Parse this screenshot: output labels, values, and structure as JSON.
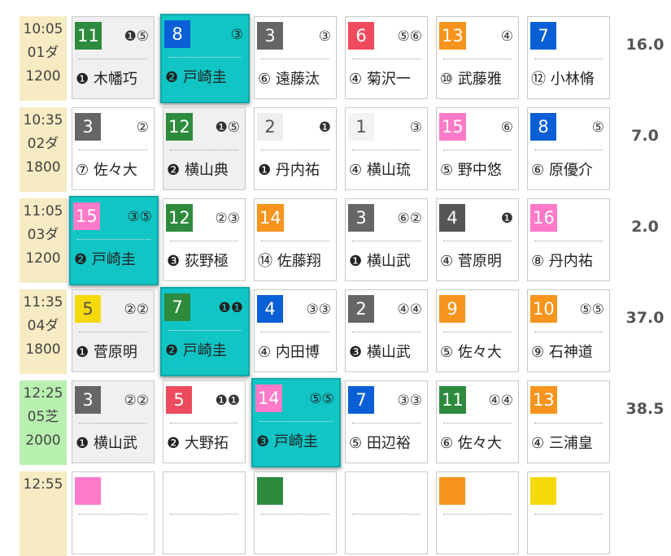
{
  "colors": {
    "highlight": "#11c5c5",
    "dirt_bg": "#f6ebc2",
    "turf_bg": "#b8f0b0"
  },
  "races": [
    {
      "time": "10:05",
      "code": "01ダ",
      "distance": "1200",
      "surface": "dirt",
      "odds": "16.0",
      "horses": [
        {
          "num": "11",
          "color": "#2e8b3e",
          "marks": "❶⑤",
          "jockey": "❶ 木幡巧",
          "highlight": false,
          "dim": true
        },
        {
          "num": "8",
          "color": "#0a5fd6",
          "marks": "③",
          "jockey": "❷ 戸崎圭",
          "highlight": true
        },
        {
          "num": "3",
          "color": "#666666",
          "marks": "③",
          "jockey": "⑥ 遠藤汰",
          "highlight": false
        },
        {
          "num": "6",
          "color": "#ee4b5e",
          "marks": "⑤⑥",
          "jockey": "④ 菊沢一",
          "highlight": false
        },
        {
          "num": "13",
          "color": "#f7941d",
          "marks": "④",
          "jockey": "⑩ 武藤雅",
          "highlight": false
        },
        {
          "num": "7",
          "color": "#0a5fd6",
          "marks": "",
          "jockey": "⑫ 小林脩",
          "highlight": false
        }
      ]
    },
    {
      "time": "10:35",
      "code": "02ダ",
      "distance": "1800",
      "surface": "dirt",
      "odds": "7.0",
      "horses": [
        {
          "num": "3",
          "color": "#666666",
          "marks": "②",
          "jockey": "⑦ 佐々大",
          "highlight": false
        },
        {
          "num": "12",
          "color": "#2e8b3e",
          "marks": "❶⑤",
          "jockey": "❷ 横山典",
          "highlight": false,
          "dim": true
        },
        {
          "num": "2",
          "color": "#eeeeee",
          "marks": "❶",
          "jockey": "❶ 丹内祐",
          "highlight": false
        },
        {
          "num": "1",
          "color": "#f3f3f3",
          "marks": "③",
          "jockey": "④ 横山琉",
          "highlight": false
        },
        {
          "num": "15",
          "color": "#ff7ac8",
          "marks": "⑥",
          "jockey": "⑤ 野中悠",
          "highlight": false
        },
        {
          "num": "8",
          "color": "#0a5fd6",
          "marks": "⑤",
          "jockey": "⑥ 原優介",
          "highlight": false
        }
      ]
    },
    {
      "time": "11:05",
      "code": "03ダ",
      "distance": "1200",
      "surface": "dirt",
      "odds": "2.0",
      "horses": [
        {
          "num": "15",
          "color": "#ff7ac8",
          "marks": "③⑤",
          "jockey": "❷ 戸崎圭",
          "highlight": true
        },
        {
          "num": "12",
          "color": "#2e8b3e",
          "marks": "②③",
          "jockey": "❸ 荻野極",
          "highlight": false
        },
        {
          "num": "14",
          "color": "#f7941d",
          "marks": "",
          "jockey": "⑭ 佐藤翔",
          "highlight": false
        },
        {
          "num": "3",
          "color": "#666666",
          "marks": "⑥②",
          "jockey": "❶ 横山武",
          "highlight": false
        },
        {
          "num": "4",
          "color": "#555555",
          "marks": "❶",
          "jockey": "④ 菅原明",
          "highlight": false
        },
        {
          "num": "16",
          "color": "#ff7ac8",
          "marks": "",
          "jockey": "⑧ 丹内祐",
          "highlight": false
        }
      ]
    },
    {
      "time": "11:35",
      "code": "04ダ",
      "distance": "1800",
      "surface": "dirt",
      "odds": "37.0",
      "horses": [
        {
          "num": "5",
          "color": "#f5d90a",
          "marks": "②②",
          "jockey": "❶ 菅原明",
          "highlight": false,
          "dim": true
        },
        {
          "num": "7",
          "color": "#2e8b3e",
          "marks": "❶❶",
          "jockey": "❷ 戸崎圭",
          "highlight": true
        },
        {
          "num": "4",
          "color": "#0a5fd6",
          "marks": "③③",
          "jockey": "④ 内田博",
          "highlight": false
        },
        {
          "num": "2",
          "color": "#666666",
          "marks": "④④",
          "jockey": "❸ 横山武",
          "highlight": false
        },
        {
          "num": "9",
          "color": "#f7941d",
          "marks": "",
          "jockey": "⑤ 佐々大",
          "highlight": false
        },
        {
          "num": "10",
          "color": "#f7941d",
          "marks": "⑤⑤",
          "jockey": "⑨ 石神道",
          "highlight": false
        }
      ]
    },
    {
      "time": "12:25",
      "code": "05芝",
      "distance": "2000",
      "surface": "turf",
      "odds": "38.5",
      "horses": [
        {
          "num": "3",
          "color": "#666666",
          "marks": "②②",
          "jockey": "❶ 横山武",
          "highlight": false,
          "dim": true
        },
        {
          "num": "5",
          "color": "#ee4b5e",
          "marks": "❶❶",
          "jockey": "❷ 大野拓",
          "highlight": false
        },
        {
          "num": "14",
          "color": "#ff7ac8",
          "marks": "⑤⑤",
          "jockey": "❸ 戸崎圭",
          "highlight": true
        },
        {
          "num": "7",
          "color": "#0a5fd6",
          "marks": "③③",
          "jockey": "⑤ 田辺裕",
          "highlight": false
        },
        {
          "num": "11",
          "color": "#2e8b3e",
          "marks": "④④",
          "jockey": "⑥ 佐々大",
          "highlight": false
        },
        {
          "num": "13",
          "color": "#f7941d",
          "marks": "",
          "jockey": "④ 三浦皇",
          "highlight": false
        }
      ]
    },
    {
      "time": "12:55",
      "code": "",
      "distance": "",
      "surface": "dirt",
      "odds": "",
      "horses": [
        {
          "num": "",
          "color": "#ff7ac8",
          "marks": "",
          "jockey": "",
          "highlight": false
        },
        {
          "num": "",
          "color": "#ffffff",
          "marks": "",
          "jockey": "",
          "highlight": false
        },
        {
          "num": "",
          "color": "#2e8b3e",
          "marks": "",
          "jockey": "",
          "highlight": false
        },
        {
          "num": "",
          "color": "#ffffff",
          "marks": "",
          "jockey": "",
          "highlight": false
        },
        {
          "num": "",
          "color": "#f7941d",
          "marks": "",
          "jockey": "",
          "highlight": false
        },
        {
          "num": "",
          "color": "#f5d90a",
          "marks": "",
          "jockey": "",
          "highlight": false
        },
        {
          "num": "",
          "color": "#ee4b5e",
          "marks": "",
          "jockey": "",
          "highlight": false
        }
      ]
    }
  ]
}
